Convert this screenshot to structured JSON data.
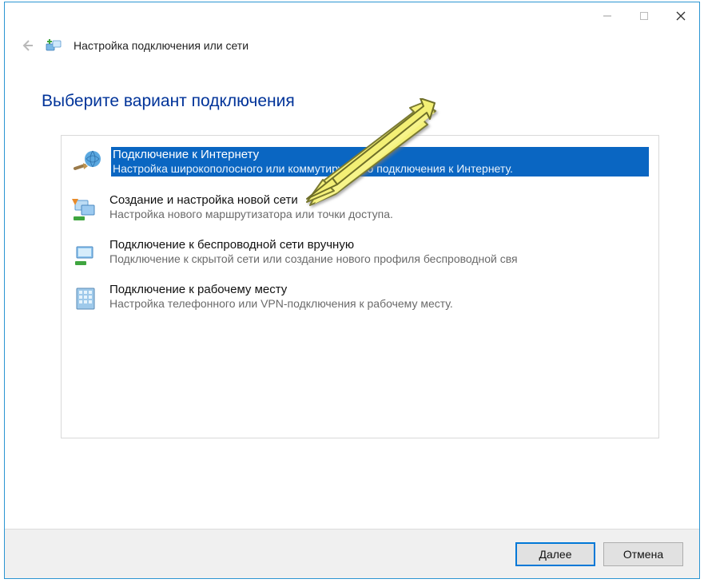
{
  "header": {
    "title": "Настройка подключения или сети"
  },
  "page": {
    "heading": "Выберите вариант подключения"
  },
  "options": [
    {
      "title": "Подключение к Интернету",
      "desc": "Настройка широкополосного или коммутируемого подключения к Интернету."
    },
    {
      "title": "Создание и настройка новой сети",
      "desc": "Настройка нового маршрутизатора или точки доступа."
    },
    {
      "title": "Подключение к беспроводной сети вручную",
      "desc": "Подключение к скрытой сети или создание нового профиля беспроводной свя"
    },
    {
      "title": "Подключение к рабочему месту",
      "desc": "Настройка телефонного или VPN-подключения к рабочему месту."
    }
  ],
  "footer": {
    "next": "Далее",
    "cancel": "Отмена"
  }
}
